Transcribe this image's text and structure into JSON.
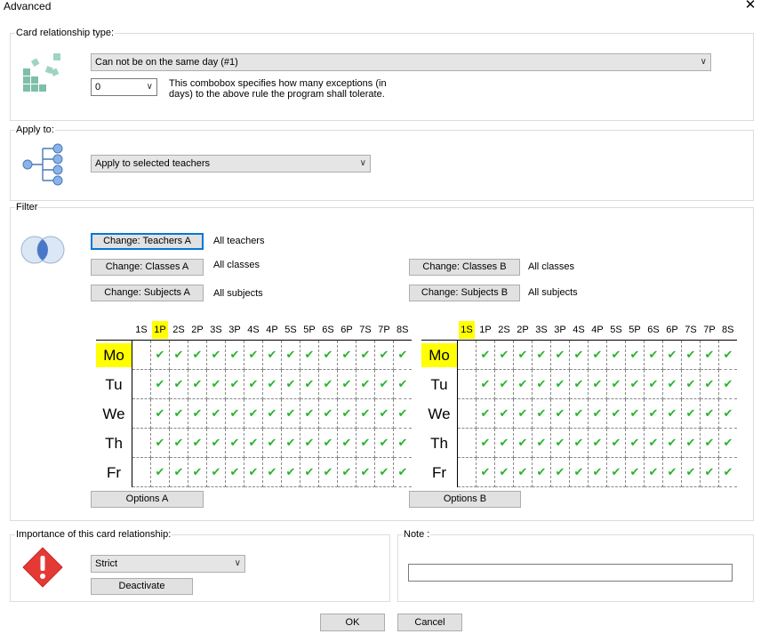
{
  "window": {
    "title": "Advanced",
    "close_glyph": "✕"
  },
  "relationship": {
    "group_label": "Card relationship type:",
    "icon": "blocks-icon",
    "type_value": "Can not be on the same day (#1)",
    "exceptions_value": "0",
    "exceptions_help": "This combobox specifies how many exceptions (in days) to the above rule the program shall tolerate."
  },
  "apply": {
    "group_label": "Apply to:",
    "icon": "tree-icon",
    "value": "Apply to selected teachers"
  },
  "filter": {
    "group_label": "Filter",
    "icon": "venn-icon",
    "teachers_a_button": "Change: Teachers A",
    "teachers_a_value": "All teachers",
    "classes_a_button": "Change: Classes A",
    "classes_a_value": "All classes",
    "subjects_a_button": "Change: Subjects A",
    "subjects_a_value": "All subjects",
    "classes_b_button": "Change: Classes B",
    "classes_b_value": "All classes",
    "subjects_b_button": "Change: Subjects B",
    "subjects_b_value": "All subjects",
    "options_a_button": "Options A",
    "options_b_button": "Options B"
  },
  "timetable": {
    "periods": [
      "1S",
      "1P",
      "2S",
      "2P",
      "3S",
      "3P",
      "4S",
      "4P",
      "5S",
      "5P",
      "6S",
      "6P",
      "7S",
      "7P",
      "8S"
    ],
    "days": [
      "Mo",
      "Tu",
      "We",
      "Th",
      "Fr"
    ],
    "check_glyph": "✔",
    "grid_a": {
      "highlight_period": "1P",
      "highlight_day": "Mo",
      "empty_periods": [
        "1S"
      ]
    },
    "grid_b": {
      "highlight_period": "1S",
      "highlight_day": "Mo",
      "empty_periods": [
        "1S"
      ]
    }
  },
  "importance": {
    "group_label": "Importance of this card relationship:",
    "icon": "warning-diamond-icon",
    "value": "Strict",
    "deactivate_button": "Deactivate"
  },
  "note": {
    "group_label": "Note :",
    "value": ""
  },
  "footer": {
    "ok_button": "OK",
    "cancel_button": "Cancel"
  },
  "colors": {
    "accent": "#0078d7",
    "highlight": "#ffff00",
    "check": "#2bb32b",
    "warning": "#e53935"
  }
}
